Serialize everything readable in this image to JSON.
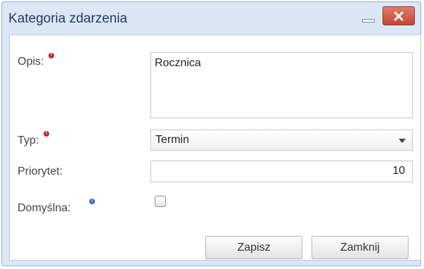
{
  "window": {
    "title": "Kategoria zdarzenia"
  },
  "form": {
    "opis": {
      "label": "Opis:",
      "value": "Rocznica"
    },
    "typ": {
      "label": "Typ:",
      "value": "Termin"
    },
    "priorytet": {
      "label": "Priorytet:",
      "value": "10"
    },
    "domyslna": {
      "label": "Domyślna:",
      "checked": false
    }
  },
  "buttons": {
    "save": "Zapisz",
    "close": "Zamknij"
  },
  "icons": {
    "required": "required-icon",
    "info": "info-icon",
    "minimize": "minimize-icon",
    "close": "close-icon",
    "dropdown": "chevron-down-icon"
  },
  "colors": {
    "titlebar": "#dbe7f5",
    "close_button": "#c6442f",
    "required": "#c8202a",
    "info": "#3b66b8"
  }
}
